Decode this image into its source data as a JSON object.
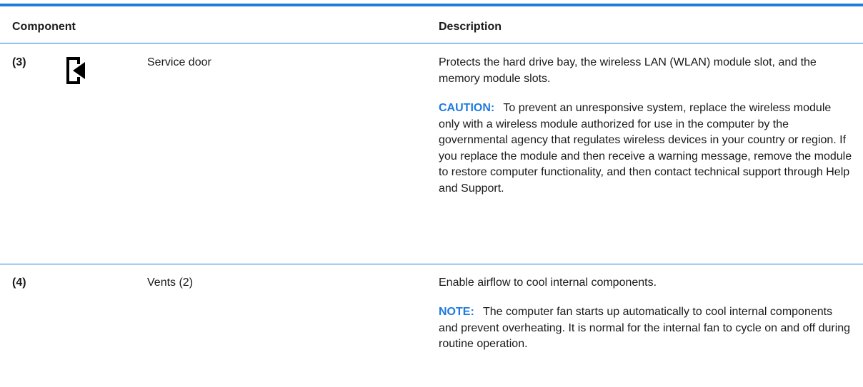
{
  "header": {
    "component_label": "Component",
    "description_label": "Description"
  },
  "rows": [
    {
      "callout": "(3)",
      "icon": "service-door-icon",
      "name": "Service door",
      "description": "Protects the hard drive bay, the wireless LAN (WLAN) module slot, and the memory module slots.",
      "note_label": "CAUTION:",
      "note_text": "To prevent an unresponsive system, replace the wireless module only with a wireless module authorized for use in the computer by the governmental agency that regulates wireless devices in your country or region. If you replace the module and then receive a warning message, remove the module to restore computer functionality, and then contact technical support through Help and Support."
    },
    {
      "callout": "(4)",
      "icon": "",
      "name": "Vents (2)",
      "description": "Enable airflow to cool internal components.",
      "note_label": "NOTE:",
      "note_text": "The computer fan starts up automatically to cool internal components and prevent overheating. It is normal for the internal fan to cycle on and off during routine operation."
    }
  ],
  "colors": {
    "accent": "#1f7ae0",
    "text": "#1a1a1a"
  }
}
